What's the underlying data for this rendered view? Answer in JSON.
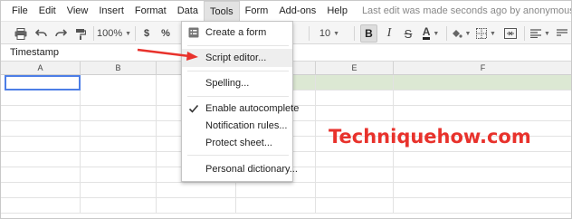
{
  "menubar": {
    "items": [
      "File",
      "Edit",
      "View",
      "Insert",
      "Format",
      "Data",
      "Tools",
      "Form",
      "Add-ons",
      "Help"
    ],
    "active_index": 6,
    "last_edit": "Last edit was made seconds ago by anonymous"
  },
  "toolbar": {
    "zoom": "100%",
    "currency": "$",
    "percent": "%",
    "font_size": "10",
    "bold": "B",
    "font_color_letter": "A",
    "icons": [
      "print-icon",
      "undo-icon",
      "redo-icon",
      "paint-format-icon",
      "bold-icon",
      "italic-icon",
      "strikethrough-icon",
      "text-color-icon",
      "fill-color-icon",
      "borders-icon",
      "merge-icon",
      "align-icon",
      "wrap-icon"
    ]
  },
  "formula_bar": {
    "content": "Timestamp"
  },
  "grid": {
    "columns": [
      "A",
      "B",
      "C",
      "D",
      "E",
      "F"
    ],
    "header_row_color": "#dce8d3",
    "selection_color": "#4d7ee6"
  },
  "tools_menu": {
    "items": [
      {
        "label": "Create a form",
        "icon": "form-icon"
      },
      {
        "label": "Script editor...",
        "highlighted": true
      },
      {
        "label": "Spelling..."
      },
      {
        "label": "Enable autocomplete",
        "checked": true,
        "icon": "check-icon"
      },
      {
        "label": "Notification rules..."
      },
      {
        "label": "Protect sheet..."
      },
      {
        "label": "Personal dictionary..."
      }
    ]
  },
  "watermark": {
    "text": "Techniquehow.com",
    "color": "#e8322c"
  }
}
